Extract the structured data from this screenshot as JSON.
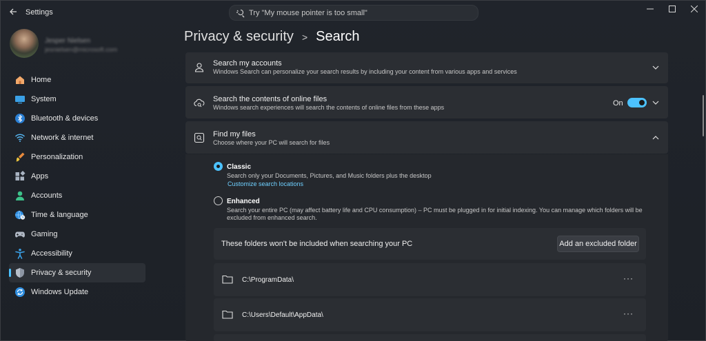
{
  "window": {
    "app_title": "Settings"
  },
  "search": {
    "placeholder": "Try \"My mouse pointer is too small\""
  },
  "profile": {
    "name": "Jesper Nielsen",
    "email": "jesnielsen@microsoft.com"
  },
  "sidebar": {
    "items": [
      {
        "label": "Home",
        "icon": "home-icon",
        "active": false
      },
      {
        "label": "System",
        "icon": "monitor-icon",
        "active": false
      },
      {
        "label": "Bluetooth & devices",
        "icon": "bluetooth-icon",
        "active": false
      },
      {
        "label": "Network & internet",
        "icon": "wifi-icon",
        "active": false
      },
      {
        "label": "Personalization",
        "icon": "paintbrush-icon",
        "active": false
      },
      {
        "label": "Apps",
        "icon": "apps-icon",
        "active": false
      },
      {
        "label": "Accounts",
        "icon": "person-icon",
        "active": false
      },
      {
        "label": "Time & language",
        "icon": "globe-clock-icon",
        "active": false
      },
      {
        "label": "Gaming",
        "icon": "gamepad-icon",
        "active": false
      },
      {
        "label": "Accessibility",
        "icon": "accessibility-icon",
        "active": false
      },
      {
        "label": "Privacy & security",
        "icon": "shield-icon",
        "active": true
      },
      {
        "label": "Windows Update",
        "icon": "update-icon",
        "active": false
      }
    ]
  },
  "breadcrumb": {
    "parent": "Privacy & security",
    "separator": ">",
    "current": "Search"
  },
  "cards": {
    "accounts": {
      "title": "Search my accounts",
      "desc": "Windows Search can personalize your search results by including your content from various apps and services"
    },
    "online": {
      "title": "Search the contents of online files",
      "desc": "Windows search experiences will search the contents of online files from these apps",
      "toggle_label": "On",
      "toggle_on": true
    },
    "findfiles": {
      "title": "Find my files",
      "desc": "Choose where your PC will search for files",
      "classic": {
        "title": "Classic",
        "desc": "Search only your Documents, Pictures, and Music folders plus the desktop",
        "link": "Customize search locations",
        "selected": true
      },
      "enhanced": {
        "title": "Enhanced",
        "desc_line1": "Search your entire PC (may affect battery life and CPU consumption) – PC must be plugged in for initial indexing. You can manage which folders will be",
        "desc_line2": "excluded from enhanced search.",
        "selected": false
      }
    }
  },
  "excluded": {
    "header": "These folders won't be included when searching your PC",
    "add_button": "Add an excluded folder",
    "folders": [
      {
        "path": "C:\\ProgramData\\",
        "more": "···"
      },
      {
        "path": "C:\\Users\\Default\\AppData\\",
        "more": "···"
      }
    ]
  },
  "colors": {
    "accent": "#4cc2ff",
    "link": "#6fd0ff",
    "card": "#2b2e33",
    "background": "#1f2329"
  }
}
